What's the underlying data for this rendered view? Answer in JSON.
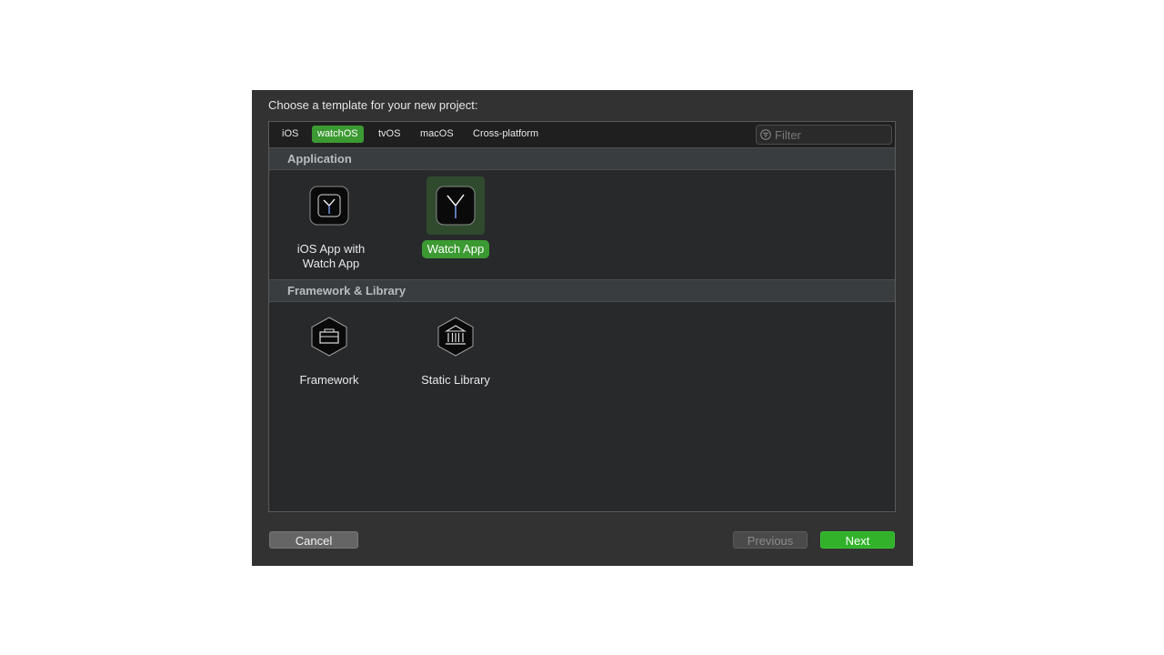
{
  "dialog": {
    "title": "Choose a template for your new project:"
  },
  "tabs": [
    {
      "label": "iOS",
      "active": false
    },
    {
      "label": "watchOS",
      "active": true
    },
    {
      "label": "tvOS",
      "active": false
    },
    {
      "label": "macOS",
      "active": false
    },
    {
      "label": "Cross-platform",
      "active": false
    }
  ],
  "filter": {
    "placeholder": "Filter",
    "icon": "filter-icon"
  },
  "sections": [
    {
      "title": "Application",
      "items": [
        {
          "label": "iOS App with Watch App",
          "icon": "watch-app-icon",
          "selected": false
        },
        {
          "label": "Watch App",
          "icon": "watch-app-icon",
          "selected": true
        }
      ]
    },
    {
      "title": "Framework & Library",
      "items": [
        {
          "label": "Framework",
          "icon": "framework-icon",
          "selected": false
        },
        {
          "label": "Static Library",
          "icon": "static-library-icon",
          "selected": false
        }
      ]
    }
  ],
  "buttons": {
    "cancel": "Cancel",
    "previous": "Previous",
    "next": "Next"
  },
  "colors": {
    "accent": "#3c9a32",
    "next_button": "#31b22a",
    "dialog_bg": "#323232"
  }
}
